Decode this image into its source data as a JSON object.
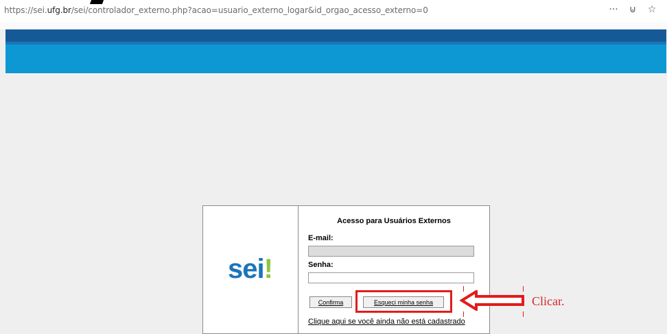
{
  "browser": {
    "url_prefix": "https://sei.",
    "url_domain": "ufg.br",
    "url_rest": "/sei/controlador_externo.php?acao=usuario_externo_logar&id_orgao_acesso_externo=0",
    "menu_icon": "···",
    "pocket_icon": "⊍",
    "star_icon": "☆"
  },
  "colors": {
    "header_dark": "#155a96",
    "header_light": "#0d97d3",
    "logo_blue": "#1a75bb",
    "logo_green": "#8dc63f",
    "annotation_red": "#e31b1b"
  },
  "logo": {
    "text": "sei",
    "excl": "!"
  },
  "login": {
    "title": "Acesso para Usuários Externos",
    "email_label": "E-mail:",
    "email_value": "",
    "password_label": "Senha:",
    "password_value": "",
    "confirm_button": "Confirma",
    "forgot_button": "Esqueci minha senha",
    "register_link": "Clique aqui se você ainda não está cadastrado"
  },
  "annotation": {
    "text": "Clicar."
  }
}
